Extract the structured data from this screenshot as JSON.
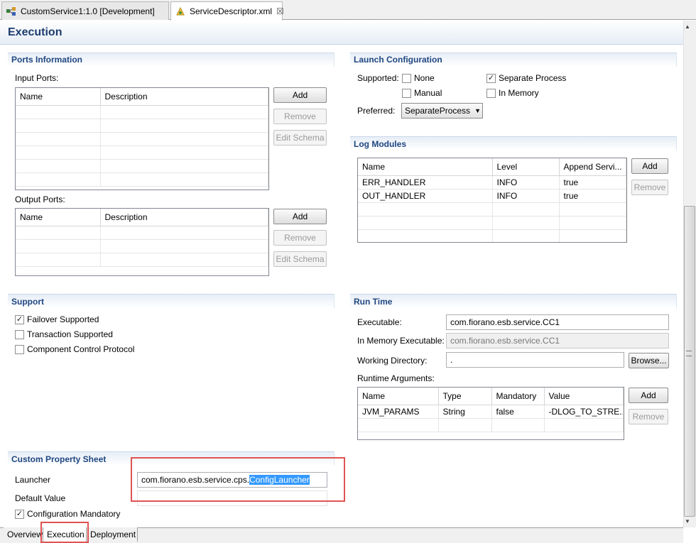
{
  "editor_tabs": [
    {
      "label": "CustomService1:1.0 [Development]"
    },
    {
      "label": "ServiceDescriptor.xml",
      "close": "☒"
    }
  ],
  "form_title": "Execution",
  "ports": {
    "title": "Ports Information",
    "input_label": "Input Ports:",
    "output_label": "Output Ports:",
    "columns": [
      "Name",
      "Description"
    ],
    "add": "Add",
    "remove": "Remove",
    "edit_schema": "Edit Schema"
  },
  "support": {
    "title": "Support",
    "items": [
      {
        "label": "Failover Supported",
        "checked": true
      },
      {
        "label": "Transaction Supported",
        "checked": false
      },
      {
        "label": "Component Control Protocol",
        "checked": false
      }
    ]
  },
  "custom_property": {
    "title": "Custom Property Sheet",
    "launcher_label": "Launcher",
    "launcher_value_prefix": "com.fiorano.esb.service.cps.",
    "launcher_value_selected": "ConfigLauncher",
    "default_label": "Default Value",
    "default_value": "",
    "mandatory_label": "Configuration Mandatory",
    "mandatory_checked": true
  },
  "launch": {
    "title": "Launch Configuration",
    "supported_label": "Supported:",
    "options": [
      {
        "label": "None",
        "checked": false
      },
      {
        "label": "Separate Process",
        "checked": true
      },
      {
        "label": "Manual",
        "checked": false
      },
      {
        "label": "In Memory",
        "checked": false
      }
    ],
    "preferred_label": "Preferred:",
    "preferred_value": "SeparateProcess"
  },
  "log_modules": {
    "title": "Log Modules",
    "columns": [
      "Name",
      "Level",
      "Append Servi..."
    ],
    "rows": [
      [
        "ERR_HANDLER",
        "INFO",
        "true"
      ],
      [
        "OUT_HANDLER",
        "INFO",
        "true"
      ]
    ],
    "add": "Add",
    "remove": "Remove"
  },
  "runtime": {
    "title": "Run Time",
    "executable_label": "Executable:",
    "executable_value": "com.fiorano.esb.service.CC1",
    "inmem_label": "In Memory Executable:",
    "inmem_value": "com.fiorano.esb.service.CC1",
    "workdir_label": "Working Directory:",
    "workdir_value": ".",
    "browse": "Browse...",
    "args_label": "Runtime Arguments:",
    "args_columns": [
      "Name",
      "Type",
      "Mandatory",
      "Value"
    ],
    "args_rows": [
      [
        "JVM_PARAMS",
        "String",
        "false",
        "-DLOG_TO_STRE..."
      ]
    ],
    "add": "Add",
    "remove": "Remove"
  },
  "bottom_tabs": [
    "Overview",
    "Execution",
    "Deployment"
  ],
  "colors": {
    "section_title": "#1f4680",
    "highlight": "#e05252",
    "selection": "#3399ff"
  }
}
